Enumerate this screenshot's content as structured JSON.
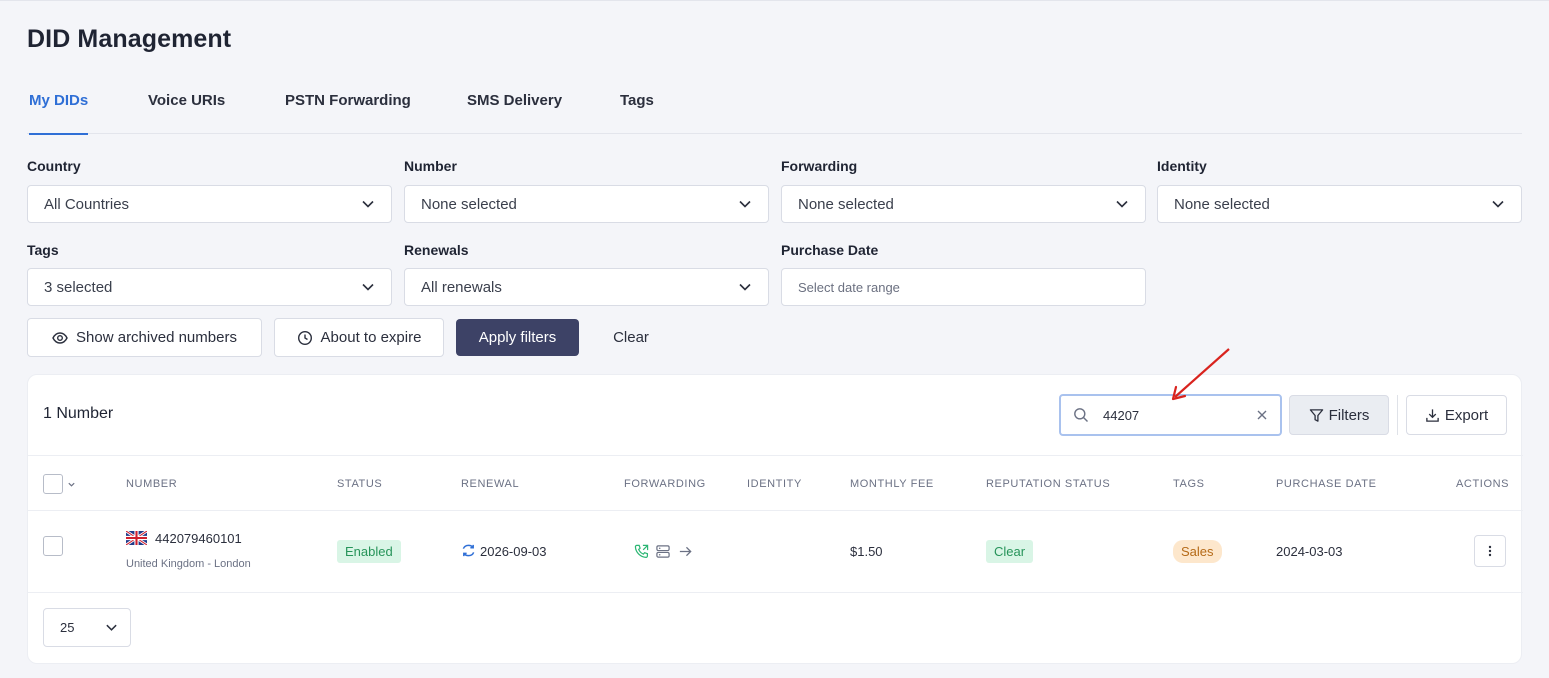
{
  "page": {
    "title": "DID Management"
  },
  "tabs": [
    {
      "label": "My DIDs",
      "active": true
    },
    {
      "label": "Voice URIs"
    },
    {
      "label": "PSTN Forwarding"
    },
    {
      "label": "SMS Delivery"
    },
    {
      "label": "Tags"
    }
  ],
  "filters": {
    "country": {
      "label": "Country",
      "value": "All Countries"
    },
    "number": {
      "label": "Number",
      "value": "None selected"
    },
    "forwarding": {
      "label": "Forwarding",
      "value": "None selected"
    },
    "identity": {
      "label": "Identity",
      "value": "None selected"
    },
    "tags": {
      "label": "Tags",
      "value": "3 selected"
    },
    "renewals": {
      "label": "Renewals",
      "value": "All renewals"
    },
    "purchase_date": {
      "label": "Purchase Date",
      "placeholder": "Select date range"
    }
  },
  "actions": {
    "show_archived": "Show archived numbers",
    "about_to_expire": "About to expire",
    "apply": "Apply filters",
    "clear": "Clear"
  },
  "table": {
    "count": "1 Number",
    "search_value": "44207",
    "filters_label": "Filters",
    "export_label": "Export",
    "columns": [
      "Number",
      "Status",
      "Renewal",
      "Forwarding",
      "Identity",
      "Monthly fee",
      "Reputation status",
      "Tags",
      "Purchase date",
      "Actions"
    ],
    "rows": [
      {
        "number": "442079460101",
        "location": "United Kingdom - London",
        "status": "Enabled",
        "renewal": "2026-09-03",
        "monthly_fee": "$1.50",
        "reputation": "Clear",
        "tag": "Sales",
        "purchase_date": "2024-03-03"
      }
    ],
    "page_size": "25"
  },
  "colors": {
    "accent": "#2f6fd6",
    "primary_button": "#3d4266",
    "status_green": "#27945a",
    "tag_orange": "#b56a17",
    "annotation_arrow": "#d9231e"
  }
}
